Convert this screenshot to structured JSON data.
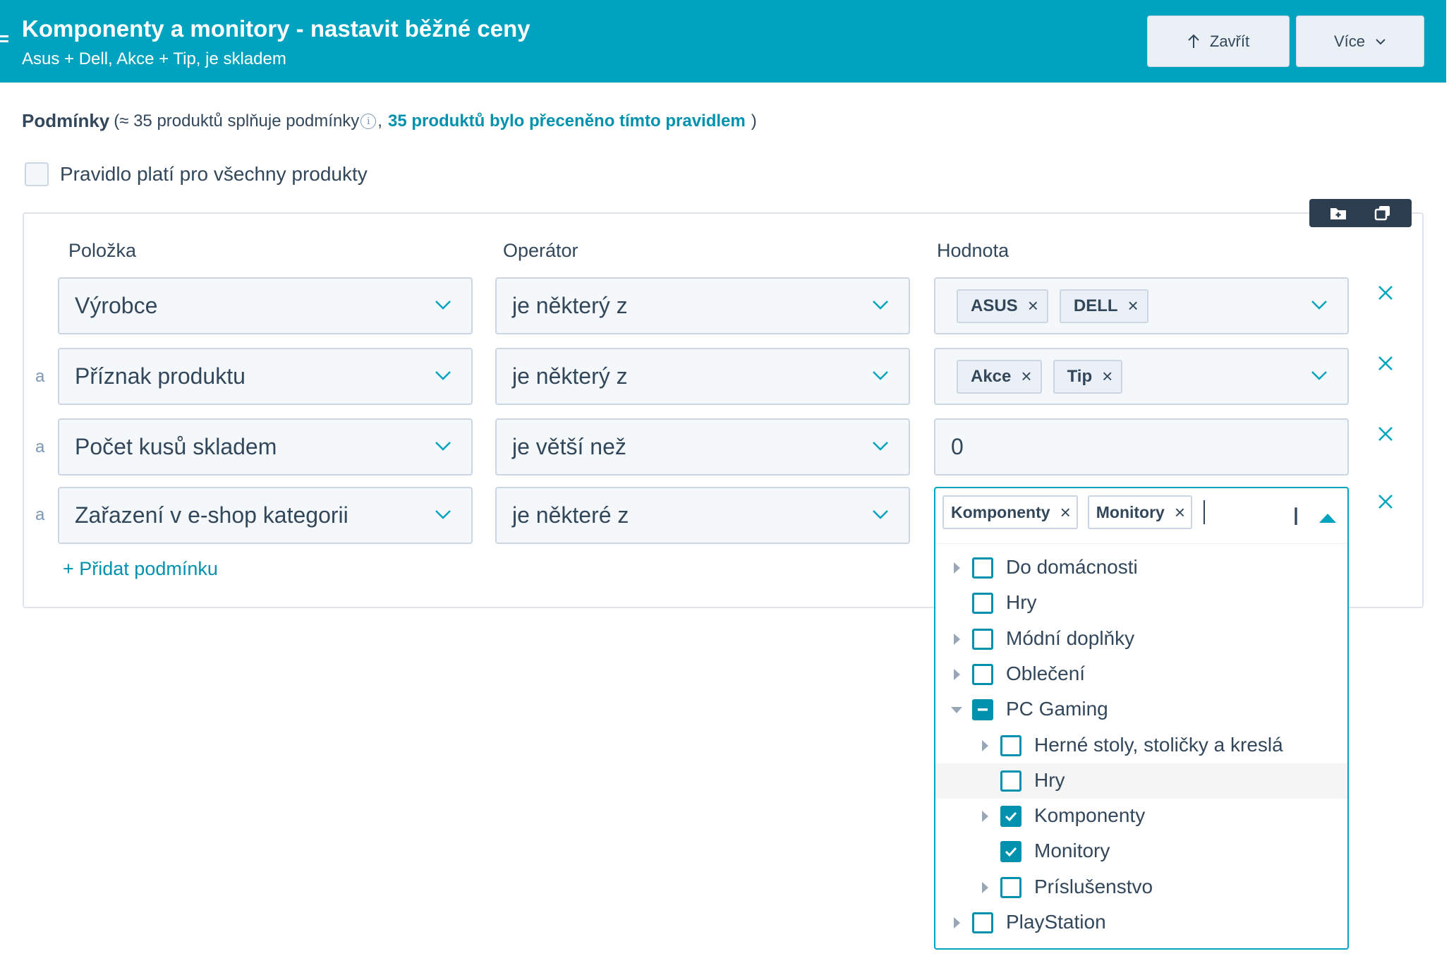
{
  "header": {
    "title": "Komponenty a monitory - nastavit běžné ceny",
    "subtitle": "Asus + Dell, Akce + Tip, je skladem",
    "close_label": "Zavřít",
    "more_label": "Více",
    "bg_color": "#00a3bf"
  },
  "conditions": {
    "heading": "Podmínky",
    "matching_prefix": "(≈ 35  produktů splňuje podmínky",
    "info_glyph": "i",
    "comma": ",",
    "repriced_text": "35  produktů bylo přeceněno tímto pravidlem",
    "close_paren": ")",
    "all_products_label": "Pravidlo platí pro všechny produkty",
    "all_products_checked": false
  },
  "table": {
    "col_item": "Položka",
    "col_operator": "Operátor",
    "col_value": "Hodnota",
    "conjunction": "a",
    "rows": [
      {
        "item": "Výrobce",
        "operator": "je některý z",
        "tags": [
          "ASUS",
          "DELL"
        ]
      },
      {
        "item": "Příznak produktu",
        "operator": "je některý z",
        "tags": [
          "Akce",
          "Tip"
        ]
      },
      {
        "item": "Počet kusů skladem",
        "operator": "je větší než",
        "value": "0"
      },
      {
        "item": "Zařazení v e-shop kategorii",
        "operator": "je některé z",
        "tags": [
          "Komponenty",
          "Monitory"
        ]
      }
    ],
    "add_condition_label": "+ Přidat podmínku"
  },
  "tree": [
    {
      "label": "Do domácnosti",
      "level": 0,
      "expander": "collapsed",
      "state": "unchecked"
    },
    {
      "label": "Hry",
      "level": 0,
      "expander": "none",
      "state": "unchecked"
    },
    {
      "label": "Módní doplňky",
      "level": 0,
      "expander": "collapsed",
      "state": "unchecked"
    },
    {
      "label": "Oblečení",
      "level": 0,
      "expander": "collapsed",
      "state": "unchecked"
    },
    {
      "label": "PC Gaming",
      "level": 0,
      "expander": "expanded",
      "state": "partial"
    },
    {
      "label": "Herné stoly, stoličky a kreslá",
      "level": 1,
      "expander": "collapsed",
      "state": "unchecked"
    },
    {
      "label": "Hry",
      "level": 1,
      "expander": "none",
      "state": "unchecked",
      "hover": true
    },
    {
      "label": "Komponenty",
      "level": 1,
      "expander": "collapsed",
      "state": "checked"
    },
    {
      "label": "Monitory",
      "level": 1,
      "expander": "none",
      "state": "checked"
    },
    {
      "label": "Príslušenstvo",
      "level": 1,
      "expander": "collapsed",
      "state": "unchecked"
    },
    {
      "label": "PlayStation",
      "level": 0,
      "expander": "collapsed",
      "state": "unchecked"
    }
  ],
  "icons": {
    "close_icon": "up-arrow-icon",
    "more_icon": "chevron-down-icon",
    "remove_icon": "close-icon",
    "tag_remove_glyph": "×"
  },
  "colors": {
    "accent": "#0091ae",
    "header": "#00a3bf",
    "toolbar": "#2d3e50"
  }
}
